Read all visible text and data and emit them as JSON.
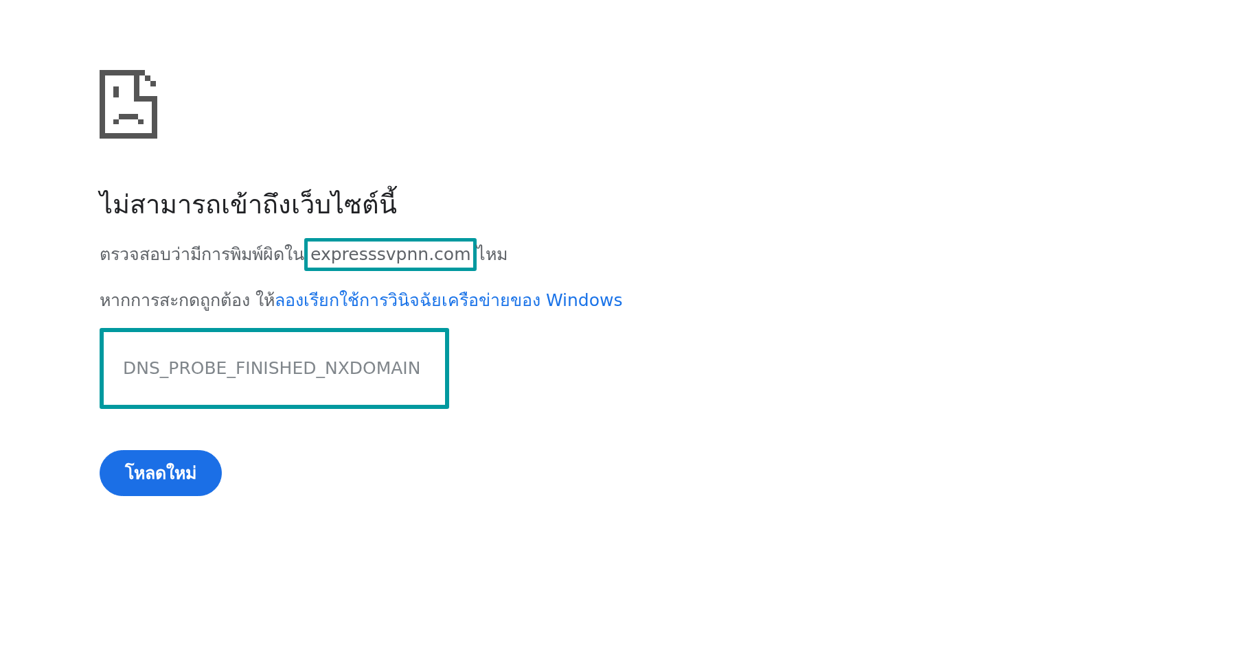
{
  "error_page": {
    "title": "ไม่สามารถเข้าถึงเว็บไซต์นี้",
    "typo_hint": {
      "before": "ตรวจสอบว่ามีการพิมพ์ผิดใน",
      "domain": "expresssvpnn.com",
      "domain_highlighted": true,
      "after": "ไหม"
    },
    "diagnostics_hint": {
      "text": "หากการสะกดถูกต้อง ให้",
      "link": "ลองเรียกใช้การวินิจฉัยเครือข่ายของ Windows"
    },
    "error_code": {
      "text": "DNS_PROBE_FINISHED_NXDOMAIN",
      "highlighted": true
    },
    "buttons": [
      {
        "label": "โหลดใหม่",
        "kind": "primary"
      }
    ]
  }
}
